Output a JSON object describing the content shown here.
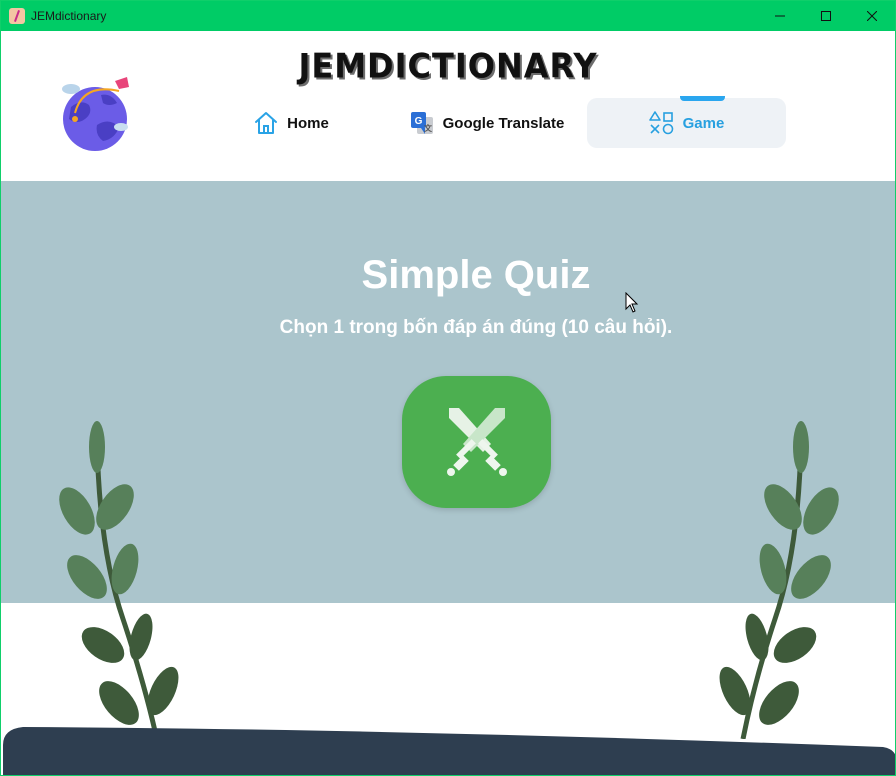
{
  "window": {
    "title": "JEMdictionary"
  },
  "header": {
    "brand": "JEMDICTIONARY",
    "nav": [
      {
        "label": "Home",
        "icon": "home-icon",
        "active": false
      },
      {
        "label": "Google Translate",
        "icon": "google-translate-icon",
        "active": false
      },
      {
        "label": "Game",
        "icon": "game-shapes-icon",
        "active": true
      }
    ]
  },
  "hero": {
    "title": "Simple Quiz",
    "subtitle": "Chọn 1 trong bốn đáp án đúng (10 câu hỏi).",
    "play_icon": "crossed-swords-icon"
  },
  "colors": {
    "titlebar": "#00cc66",
    "hero_bg": "#abc5cc",
    "play_button": "#4caf50",
    "active_nav": "#27a0e0",
    "ground": "#2e3e50",
    "leaf_dark": "#3e5a3a",
    "leaf_light": "#57805a"
  }
}
